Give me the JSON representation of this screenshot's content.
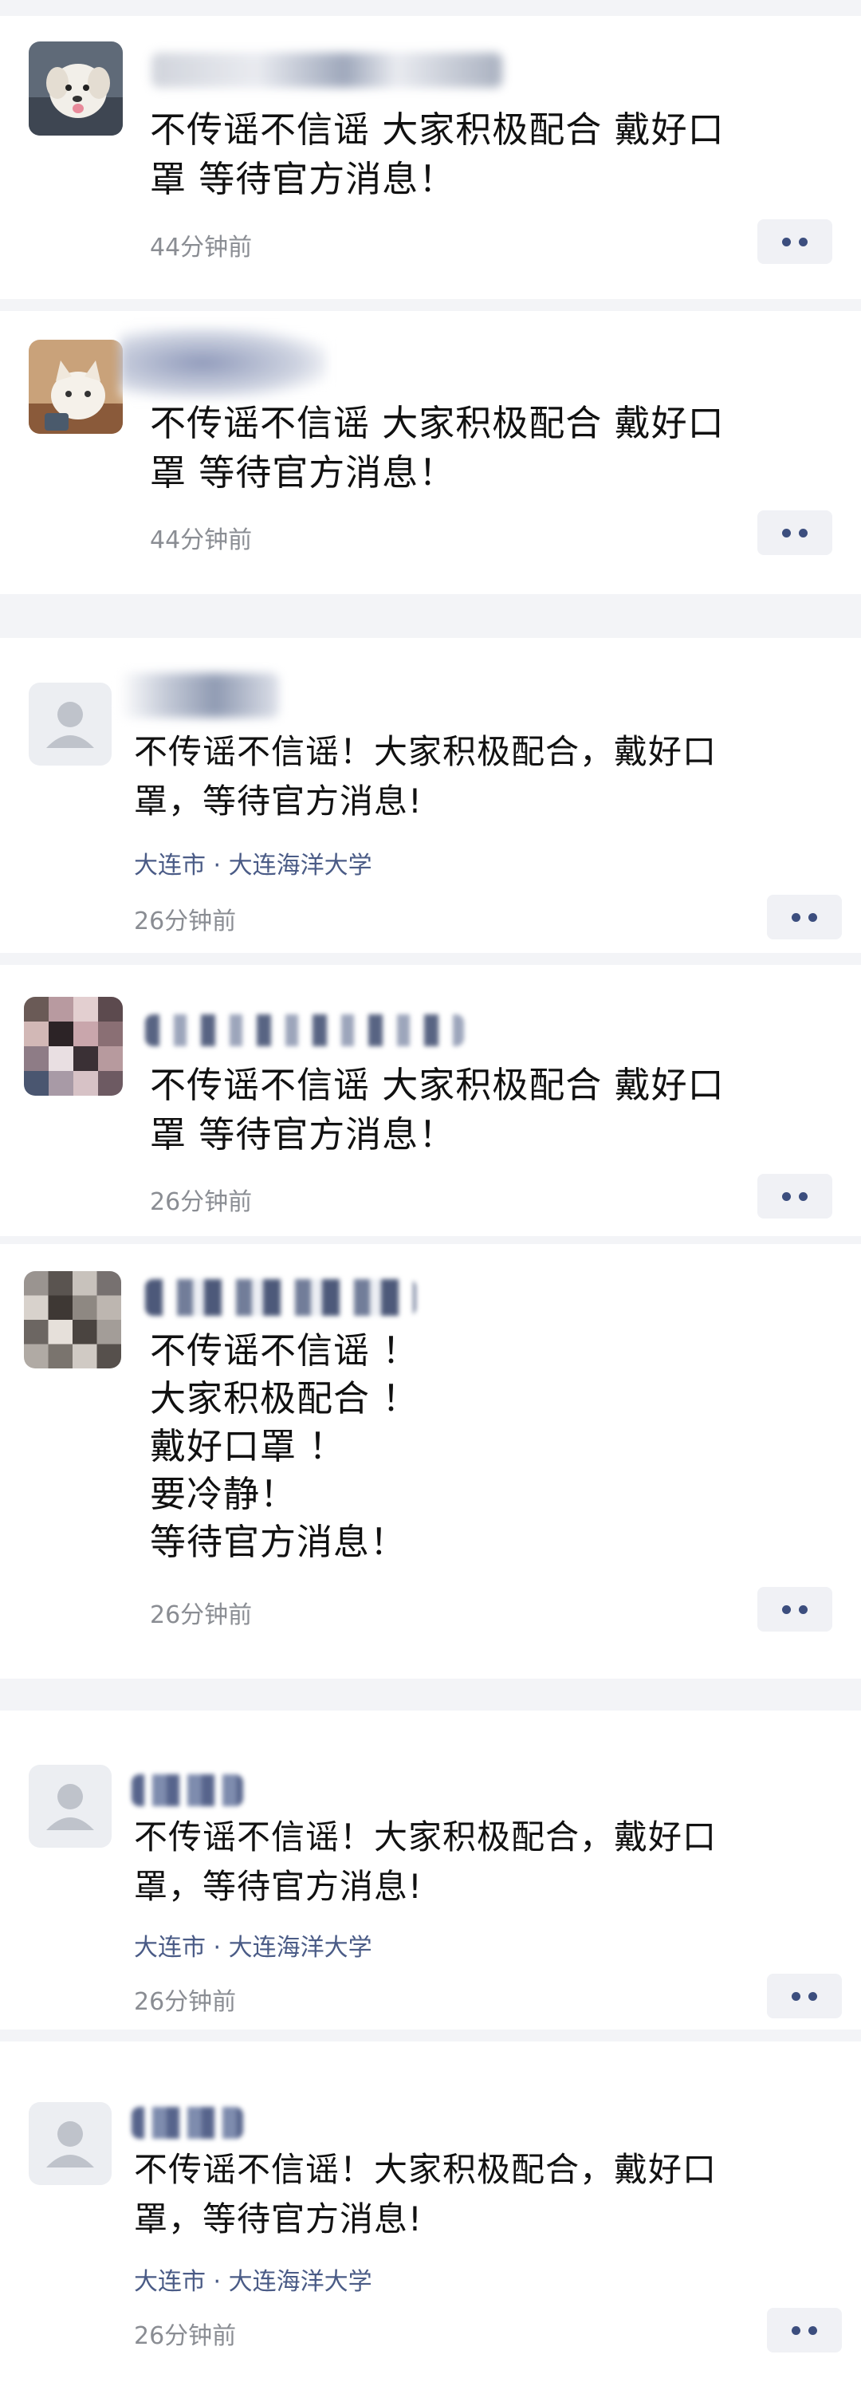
{
  "posts": [
    {
      "text": "不传谣不信谣 大家积极配合 戴好口\n罩 等待官方消息！",
      "time": "44分钟前",
      "avatar_icon": "dog-photo-avatar",
      "more_icon": "more-dots-icon"
    },
    {
      "text": "不传谣不信谣 大家积极配合 戴好口\n罩 等待官方消息！",
      "time": "44分钟前",
      "avatar_icon": "cat-photo-avatar",
      "more_icon": "more-dots-icon"
    },
    {
      "text": "不传谣不信谣！大家积极配合，戴好口\n罩，等待官方消息!",
      "location": "大连市 · 大连海洋大学",
      "time": "26分钟前",
      "avatar_icon": "default-user-avatar",
      "more_icon": "more-dots-icon"
    },
    {
      "text": "不传谣不信谣 大家积极配合 戴好口\n罩 等待官方消息！",
      "time": "26分钟前",
      "avatar_icon": "pixelated-photo-avatar",
      "more_icon": "more-dots-icon"
    },
    {
      "text": "不传谣不信谣 ！\n大家积极配合 ！\n戴好口罩 ！\n要冷静！\n等待官方消息！",
      "time": "26分钟前",
      "avatar_icon": "pixelated-photo-avatar",
      "more_icon": "more-dots-icon"
    },
    {
      "text": "不传谣不信谣！大家积极配合，戴好口\n罩，等待官方消息!",
      "location": "大连市 · 大连海洋大学",
      "time": "26分钟前",
      "avatar_icon": "default-user-avatar",
      "more_icon": "more-dots-icon"
    },
    {
      "text": "不传谣不信谣！大家积极配合，戴好口\n罩，等待官方消息!",
      "location": "大连市 · 大连海洋大学",
      "time": "26分钟前",
      "avatar_icon": "default-user-avatar",
      "more_icon": "more-dots-icon"
    }
  ],
  "colors": {
    "background": "#f3f4f7",
    "card": "#ffffff",
    "location_link": "#4a5b86",
    "timestamp": "#8a8d93",
    "more_dots": "#3c4e7e"
  }
}
